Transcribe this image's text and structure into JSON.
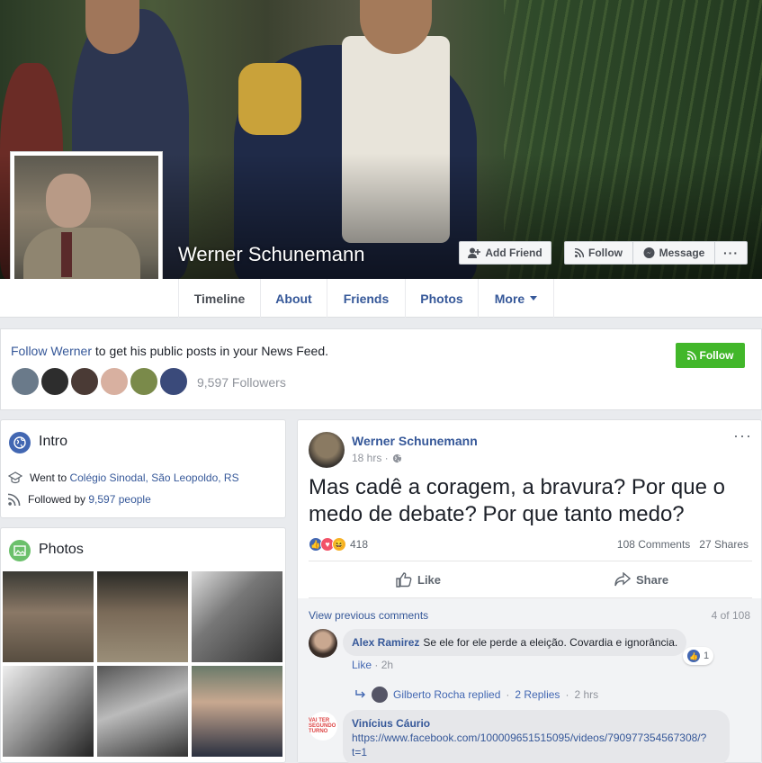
{
  "profile": {
    "name": "Werner Schunemann",
    "buttons": {
      "add_friend": "Add Friend",
      "follow": "Follow",
      "message": "Message",
      "more": "···"
    }
  },
  "tabs": [
    {
      "label": "Timeline"
    },
    {
      "label": "About"
    },
    {
      "label": "Friends"
    },
    {
      "label": "Photos"
    },
    {
      "label": "More"
    }
  ],
  "follow_box": {
    "link_text": "Follow Werner",
    "rest_text": " to get his public posts in your News Feed.",
    "button_label": "Follow",
    "followers_text": "9,597 Followers"
  },
  "intro": {
    "title": "Intro",
    "went_to_prefix": "Went to ",
    "school": "Colégio Sinodal, São Leopoldo, RS",
    "followed_prefix": "Followed by ",
    "followed_link": "9,597 people"
  },
  "photos": {
    "title": "Photos"
  },
  "post": {
    "author": "Werner Schunemann",
    "time": "18 hrs · ",
    "more": "···",
    "text": "Mas cadê a coragem, a bravura? Por que o medo de debate? Por que tanto medo?",
    "reaction_count": "418",
    "comments_count": "108 Comments",
    "shares_count": "27 Shares",
    "like_label": "Like",
    "share_label": "Share"
  },
  "comments": {
    "view_previous": "View previous comments",
    "position": "4 of 108",
    "items": [
      {
        "author": "Alex Ramirez",
        "text": "Se ele for ele perde a eleição. Covardia e ignorância.",
        "like_action": "Like",
        "time": "2h",
        "likes": "1",
        "reply_author": "Gilberto Rocha replied",
        "reply_count": "2 Replies",
        "reply_time": "2 hrs"
      },
      {
        "author": "Vinícius Cáurio",
        "text": "https://www.facebook.com/100009651515095/videos/790977354567308/?t=1",
        "avatar_text": "VAI TER SEGUNDO TURNO"
      }
    ]
  },
  "colors": {
    "link": "#365899",
    "green": "#42b72a",
    "bg": "#e9ebee"
  }
}
